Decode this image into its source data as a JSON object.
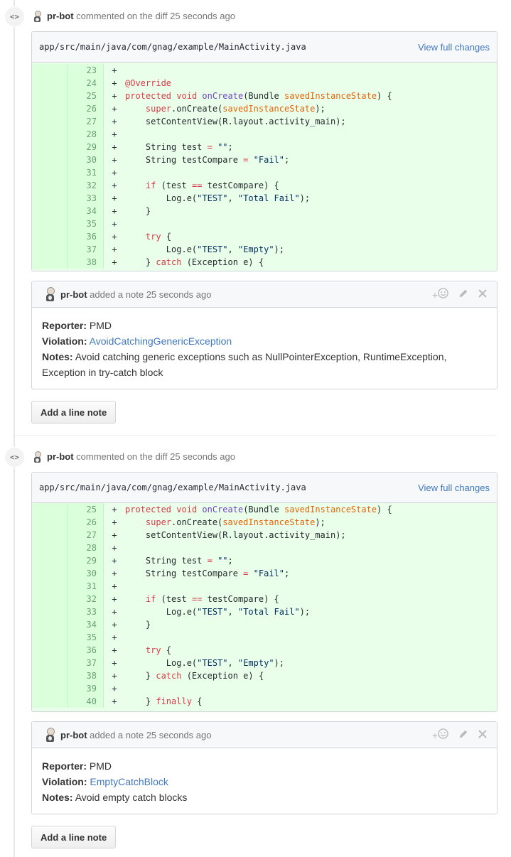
{
  "threads": [
    {
      "header": {
        "author": "pr-bot",
        "action": "commented on the diff 25 seconds ago"
      },
      "file": {
        "path": "app/src/main/java/com/gnag/example/MainActivity.java",
        "view_label": "View full changes"
      },
      "lines": [
        {
          "num": "23",
          "sign": "+",
          "code": ""
        },
        {
          "num": "24",
          "sign": "+",
          "code": "@Override"
        },
        {
          "num": "25",
          "sign": "+",
          "code": "protected void onCreate(Bundle savedInstanceState) {"
        },
        {
          "num": "26",
          "sign": "+",
          "code": "    super.onCreate(savedInstanceState);"
        },
        {
          "num": "27",
          "sign": "+",
          "code": "    setContentView(R.layout.activity_main);"
        },
        {
          "num": "28",
          "sign": "+",
          "code": ""
        },
        {
          "num": "29",
          "sign": "+",
          "code": "    String test = \"\";"
        },
        {
          "num": "30",
          "sign": "+",
          "code": "    String testCompare = \"Fail\";"
        },
        {
          "num": "31",
          "sign": "+",
          "code": ""
        },
        {
          "num": "32",
          "sign": "+",
          "code": "    if (test == testCompare) {"
        },
        {
          "num": "33",
          "sign": "+",
          "code": "        Log.e(\"TEST\", \"Total Fail\");"
        },
        {
          "num": "34",
          "sign": "+",
          "code": "    }"
        },
        {
          "num": "35",
          "sign": "+",
          "code": ""
        },
        {
          "num": "36",
          "sign": "+",
          "code": "    try {"
        },
        {
          "num": "37",
          "sign": "+",
          "code": "        Log.e(\"TEST\", \"Empty\");"
        },
        {
          "num": "38",
          "sign": "+",
          "code": "    } catch (Exception e) {"
        }
      ],
      "note": {
        "author": "pr-bot",
        "action": "added a note 25 seconds ago",
        "reporter_label": "Reporter:",
        "reporter": "PMD",
        "violation_label": "Violation:",
        "violation": "AvoidCatchingGenericException",
        "notes_label": "Notes:",
        "notes_line1": "Avoid catching generic exceptions such as NullPointerException, RuntimeException,",
        "notes_line2": "Exception in try-catch block",
        "add_reaction": "+☺"
      },
      "add_note_label": "Add a line note"
    },
    {
      "header": {
        "author": "pr-bot",
        "action": "commented on the diff 25 seconds ago"
      },
      "file": {
        "path": "app/src/main/java/com/gnag/example/MainActivity.java",
        "view_label": "View full changes"
      },
      "lines": [
        {
          "num": "25",
          "sign": "+",
          "code": "protected void onCreate(Bundle savedInstanceState) {"
        },
        {
          "num": "26",
          "sign": "+",
          "code": "    super.onCreate(savedInstanceState);"
        },
        {
          "num": "27",
          "sign": "+",
          "code": "    setContentView(R.layout.activity_main);"
        },
        {
          "num": "28",
          "sign": "+",
          "code": ""
        },
        {
          "num": "29",
          "sign": "+",
          "code": "    String test = \"\";"
        },
        {
          "num": "30",
          "sign": "+",
          "code": "    String testCompare = \"Fail\";"
        },
        {
          "num": "31",
          "sign": "+",
          "code": ""
        },
        {
          "num": "32",
          "sign": "+",
          "code": "    if (test == testCompare) {"
        },
        {
          "num": "33",
          "sign": "+",
          "code": "        Log.e(\"TEST\", \"Total Fail\");"
        },
        {
          "num": "34",
          "sign": "+",
          "code": "    }"
        },
        {
          "num": "35",
          "sign": "+",
          "code": ""
        },
        {
          "num": "36",
          "sign": "+",
          "code": "    try {"
        },
        {
          "num": "37",
          "sign": "+",
          "code": "        Log.e(\"TEST\", \"Empty\");"
        },
        {
          "num": "38",
          "sign": "+",
          "code": "    } catch (Exception e) {"
        },
        {
          "num": "39",
          "sign": "+",
          "code": ""
        },
        {
          "num": "40",
          "sign": "+",
          "code": "    } finally {"
        }
      ],
      "note": {
        "author": "pr-bot",
        "action": "added a note 25 seconds ago",
        "reporter_label": "Reporter:",
        "reporter": "PMD",
        "violation_label": "Violation:",
        "violation": "EmptyCatchBlock",
        "notes_label": "Notes:",
        "notes_line1": "Avoid empty catch blocks",
        "notes_line2": "",
        "add_reaction": "+☺"
      },
      "add_note_label": "Add a line note"
    }
  ],
  "icons": {
    "event": "<>",
    "reaction": "smiley-icon",
    "edit": "pencil-icon",
    "close": "close-icon"
  },
  "colors": {
    "diff_bg": "#eaffea",
    "link": "#4078c0"
  }
}
